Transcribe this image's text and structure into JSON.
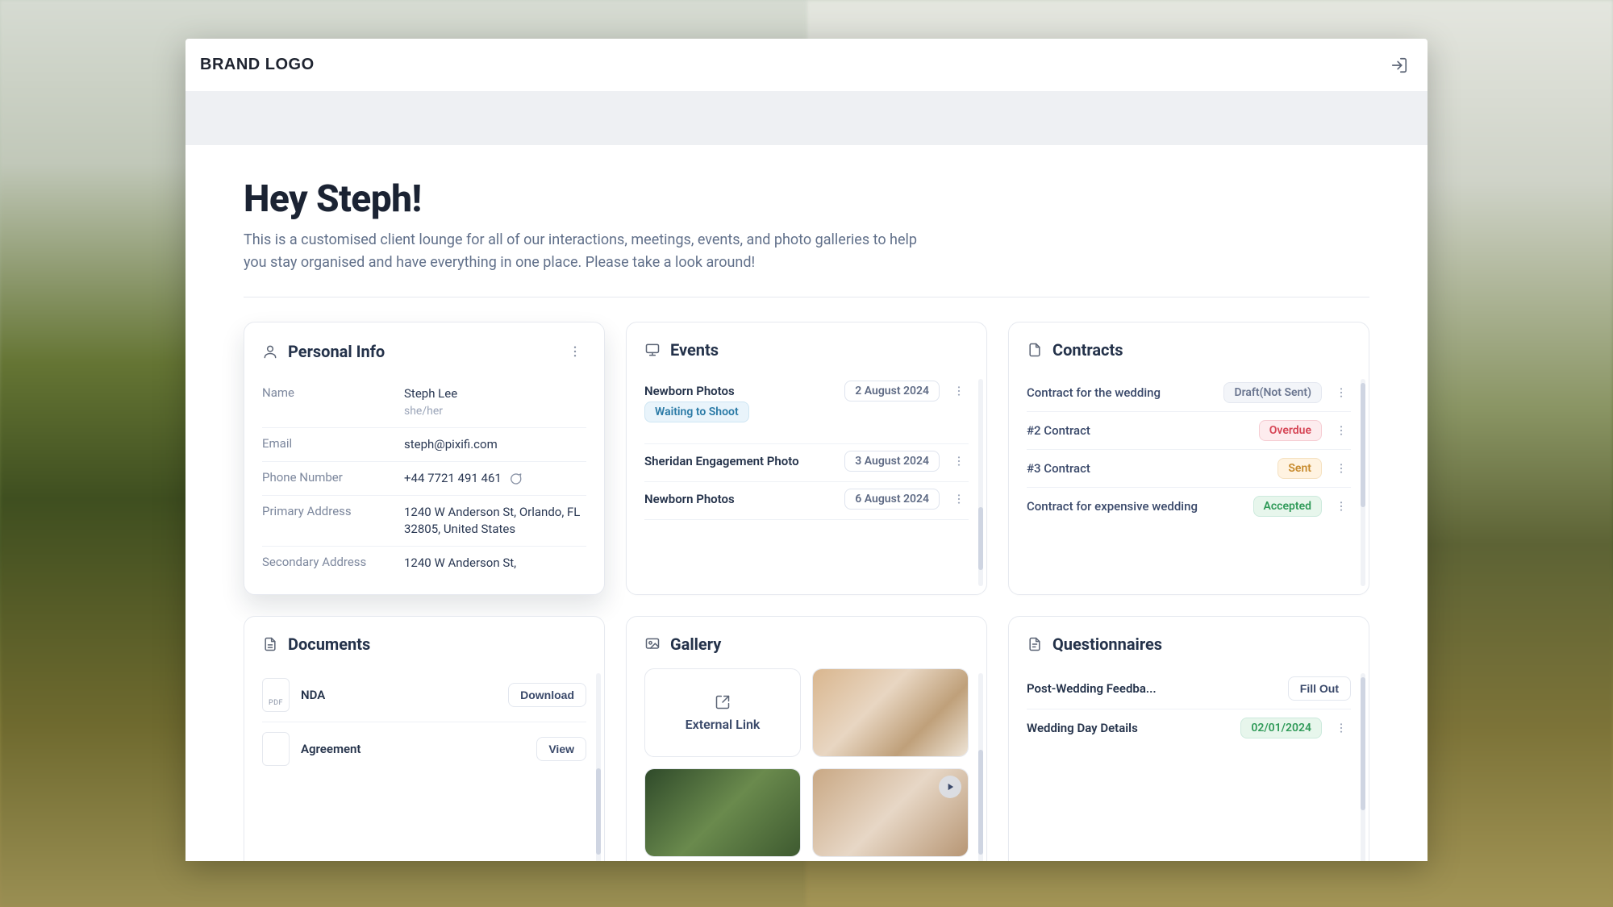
{
  "brand": "BRAND LOGO",
  "greeting": "Hey Steph!",
  "intro": "This is a customised client lounge for all of our interactions, meetings, events, and photo galleries to help you stay organised and have everything in one place. Please take a look around!",
  "personal": {
    "title": "Personal Info",
    "labels": {
      "name": "Name",
      "email": "Email",
      "phone": "Phone Number",
      "primary": "Primary Address",
      "secondary": "Secondary Address"
    },
    "values": {
      "name": "Steph Lee",
      "pronoun": "she/her",
      "email": "steph@pixifi.com",
      "phone": "+44 7721 491 461",
      "primary": "1240 W Anderson St, Orlando, FL 32805, United States",
      "secondary": "1240 W Anderson St,"
    }
  },
  "events": {
    "title": "Events",
    "items": [
      {
        "name": "Newborn Photos",
        "date": "2 August 2024",
        "status": "Waiting to Shoot"
      },
      {
        "name": "Sheridan Engagement Photo",
        "date": "3 August 2024"
      },
      {
        "name": "Newborn Photos",
        "date": "6 August 2024"
      }
    ]
  },
  "contracts": {
    "title": "Contracts",
    "items": [
      {
        "name": "Contract for the wedding",
        "badge": "Draft(Not Sent)",
        "style": "muted"
      },
      {
        "name": "#2 Contract",
        "badge": "Overdue",
        "style": "red"
      },
      {
        "name": "#3 Contract",
        "badge": "Sent",
        "style": "amber"
      },
      {
        "name": "Contract for expensive wedding",
        "badge": "Accepted",
        "style": "green"
      }
    ]
  },
  "documents": {
    "title": "Documents",
    "items": [
      {
        "name": "NDA",
        "type": "PDF",
        "action": "Download"
      },
      {
        "name": "Agreement",
        "type": "",
        "action": "View"
      }
    ]
  },
  "gallery": {
    "title": "Gallery",
    "external_label": "External Link"
  },
  "questionnaires": {
    "title": "Questionnaires",
    "items": [
      {
        "name": "Post-Wedding Feedba...",
        "badge": "Fill Out",
        "style": "muted"
      },
      {
        "name": "Wedding Day Details",
        "badge": "02/01/2024",
        "style": "green"
      }
    ]
  }
}
